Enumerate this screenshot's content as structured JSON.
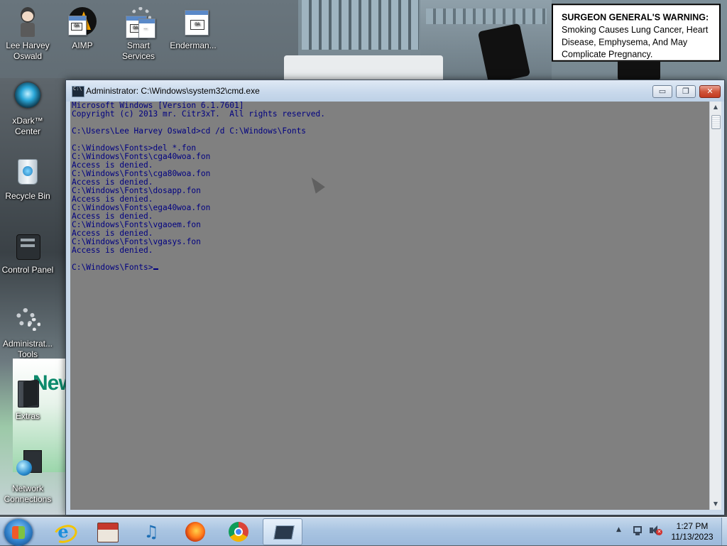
{
  "desktop": {
    "icons": [
      {
        "label": "Lee Harvey Oswald",
        "icon": "user-figure-icon"
      },
      {
        "label": "AIMP",
        "icon": "aimp-icon"
      },
      {
        "label": "Smart Services",
        "icon": "gear-document-icon"
      },
      {
        "label": "Enderman...",
        "icon": "document-icon"
      },
      {
        "label": "xDark™ Center",
        "icon": "xdark-orb-icon"
      },
      {
        "label": "Recycle Bin",
        "icon": "recycle-bin-icon"
      },
      {
        "label": "Control Panel",
        "icon": "control-panel-icon"
      },
      {
        "label": "Administrat... Tools",
        "icon": "gears-icon"
      },
      {
        "label": "Extras",
        "icon": "folder-icon"
      },
      {
        "label": "Network Connections",
        "icon": "network-globe-icon"
      }
    ],
    "wallpaper_sign": {
      "heading": "SURGEON GENERAL'S WARNING:",
      "text": "Smoking Causes Lung Cancer, Heart Disease, Emphysema, And May Complicate Pregnancy."
    },
    "wallpaper_billboard_text": "New"
  },
  "window": {
    "title": "Administrator: C:\\Windows\\system32\\cmd.exe",
    "buttons": {
      "minimize": "▭",
      "maximize": "❐",
      "close": "✕"
    },
    "console": {
      "text_color": "#000080",
      "background": "#808080",
      "lines": [
        "Microsoft Windows [Version 6.1.7601]",
        "Copyright (c) 2013 mr. Citr3xT.  All rights reserved.",
        "",
        "C:\\Users\\Lee Harvey Oswald>cd /d C:\\Windows\\Fonts",
        "",
        "C:\\Windows\\Fonts>del *.fon",
        "C:\\Windows\\Fonts\\cga40woa.fon",
        "Access is denied.",
        "C:\\Windows\\Fonts\\cga80woa.fon",
        "Access is denied.",
        "C:\\Windows\\Fonts\\dosapp.fon",
        "Access is denied.",
        "C:\\Windows\\Fonts\\ega40woa.fon",
        "Access is denied.",
        "C:\\Windows\\Fonts\\vgaoem.fon",
        "Access is denied.",
        "C:\\Windows\\Fonts\\vgasys.fon",
        "Access is denied.",
        ""
      ],
      "prompt": "C:\\Windows\\Fonts>"
    }
  },
  "taskbar": {
    "pinned": [
      {
        "name": "internet-explorer-icon",
        "glyph": "e"
      },
      {
        "name": "store-icon",
        "glyph": ""
      },
      {
        "name": "music-icon",
        "glyph": "♫"
      },
      {
        "name": "firefox-icon",
        "glyph": ""
      },
      {
        "name": "chrome-icon",
        "glyph": ""
      },
      {
        "name": "cmd-icon",
        "glyph": ""
      }
    ],
    "tray": {
      "up_arrow": "▲"
    },
    "clock": {
      "time": "1:27 PM",
      "date": "11/13/2023"
    }
  }
}
